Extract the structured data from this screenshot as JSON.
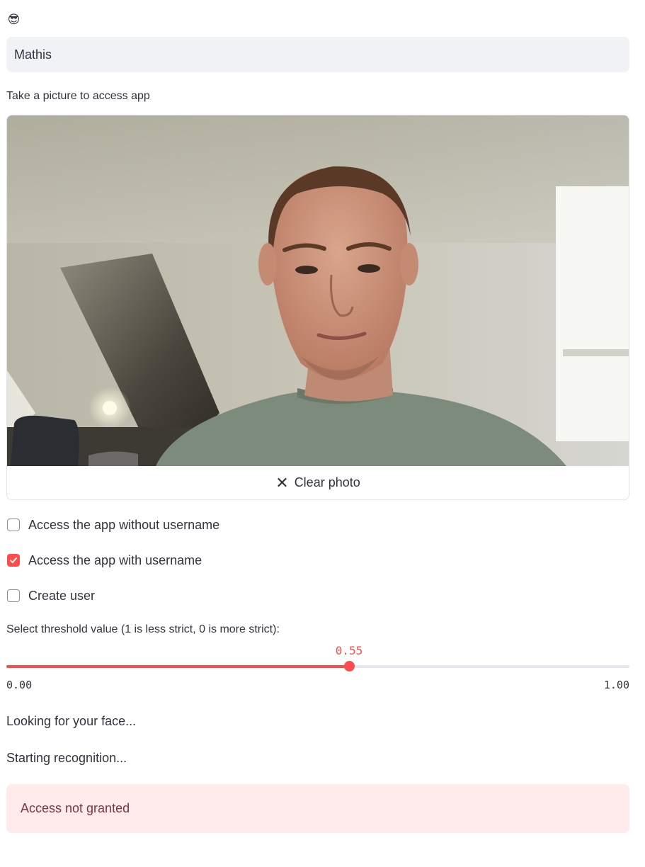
{
  "header": {
    "emoji": "😎"
  },
  "username_input": {
    "value": "Mathis"
  },
  "camera": {
    "label": "Take a picture to access app",
    "clear_button_label": "Clear photo",
    "clear_icon": "close-icon"
  },
  "checkboxes": [
    {
      "label": "Access the app without username",
      "checked": false
    },
    {
      "label": "Access the app with username",
      "checked": true
    },
    {
      "label": "Create user",
      "checked": false
    }
  ],
  "slider": {
    "label": "Select threshold value (1 is less strict, 0 is more strict):",
    "value": 0.55,
    "value_text": "0.55",
    "min": 0.0,
    "max": 1.0,
    "min_text": "0.00",
    "max_text": "1.00"
  },
  "status": {
    "line1": "Looking for your face...",
    "line2": "Starting recognition..."
  },
  "alert": {
    "message": "Access not granted"
  },
  "colors": {
    "accent": "#ff4b4b",
    "input_bg": "#f0f2f6",
    "alert_bg": "#ffebeb",
    "alert_text": "#7d353b"
  }
}
